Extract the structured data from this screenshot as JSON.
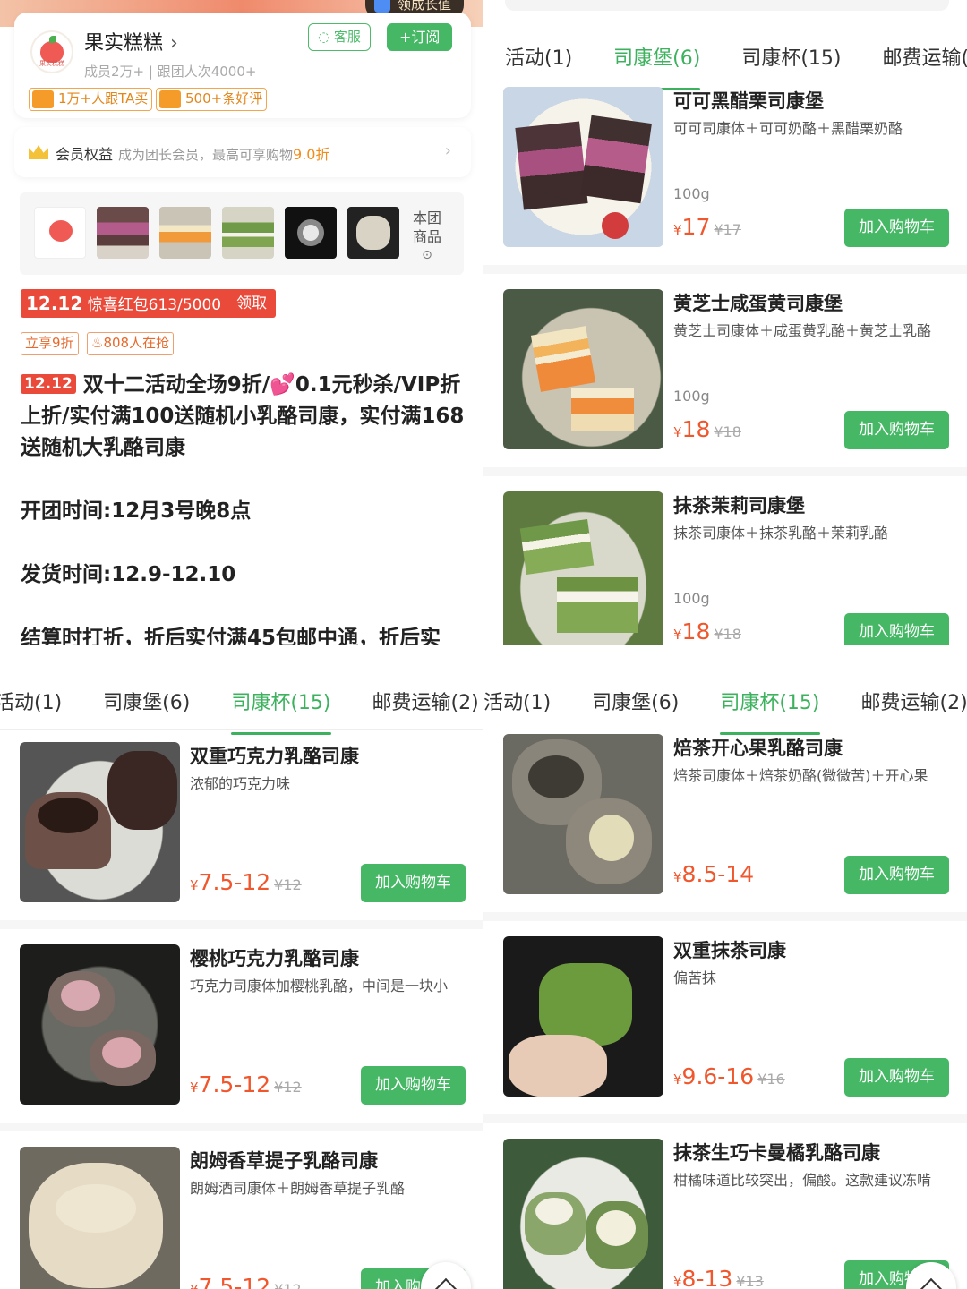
{
  "shop": {
    "banner_pill": "领成长值",
    "name": "果实糕糕",
    "meta": "成员2万+ | 跟团人次4000+",
    "service_label": "客服",
    "subscribe_label": "+订阅",
    "tag_follow": "1万+人跟TA买",
    "tag_reviews": "500+条好评",
    "logo_text": "果实糕糕"
  },
  "member": {
    "title": "会员权益",
    "desc": "成为团长会员，最高可享购物",
    "discount": "9.0折"
  },
  "thumbs": {
    "more_label": "本团商品"
  },
  "coupon": {
    "date": "12.12",
    "label": "惊喜红包613/5000",
    "claim": "领取"
  },
  "chips": {
    "discount": "立享9折",
    "grabbing": "808人在抢"
  },
  "description": {
    "badge": "12.12",
    "line1": "双十二活动全场9折/💕0.1元秒杀/VIP折上折/实付满100送随机小乳酪司康，实付满168送随机大乳酪司康",
    "line2": "开团时间:12月3号晚8点",
    "line3": "发货时间:12.9-12.10",
    "line4": "结算时打折，折后实付满45包邮中通，折后实"
  },
  "tabs": [
    "活动(1)",
    "司康堡(6)",
    "司康杯(15)",
    "邮费运输(2)"
  ],
  "add_label": "加入购物车",
  "panel_burgers": [
    {
      "name": "可可黑醋栗司康堡",
      "sub": "可可司康体＋可可奶酪＋黑醋栗奶酪",
      "weight": "100g",
      "price": "17",
      "orig": "¥17"
    },
    {
      "name": "黄芝士咸蛋黄司康堡",
      "sub": "黄芝士司康体＋咸蛋黄乳酪＋黄芝士乳酪",
      "weight": "100g",
      "price": "18",
      "orig": "¥18"
    },
    {
      "name": "抹茶茉莉司康堡",
      "sub": "抹茶司康体＋抹茶乳酪＋茉莉乳酪",
      "weight": "100g",
      "price": "18",
      "orig": "¥18"
    }
  ],
  "panel_cups_left": [
    {
      "name": "双重巧克力乳酪司康",
      "sub": "浓郁的巧克力味",
      "price": "7.5-12",
      "orig": "¥12"
    },
    {
      "name": "樱桃巧克力乳酪司康",
      "sub": "巧克力司康体加樱桃乳酪，中间是一块小",
      "price": "7.5-12",
      "orig": "¥12"
    },
    {
      "name": "朗姆香草提子乳酪司康",
      "sub": "朗姆酒司康体＋朗姆香草提子乳酪",
      "price": "7.5-12",
      "orig": "¥12"
    }
  ],
  "panel_cups_right": [
    {
      "name": "焙茶开心果乳酪司康",
      "sub": "焙茶司康体＋焙茶奶酪(微微苦)＋开心果",
      "price": "8.5-14",
      "orig": ""
    },
    {
      "name": "双重抹茶司康",
      "sub": "偏苦抹",
      "price": "9.6-16",
      "orig": "¥16"
    },
    {
      "name": "抹茶生巧卡曼橘乳酪司康",
      "sub": "柑橘味道比较突出，偏酸。这款建议冻啃",
      "price": "8-13",
      "orig": "¥13"
    }
  ],
  "currency": "¥",
  "colors": {
    "accent_green": "#45b765",
    "price_orange": "#f0572d",
    "coupon_red": "#e94a3a"
  }
}
